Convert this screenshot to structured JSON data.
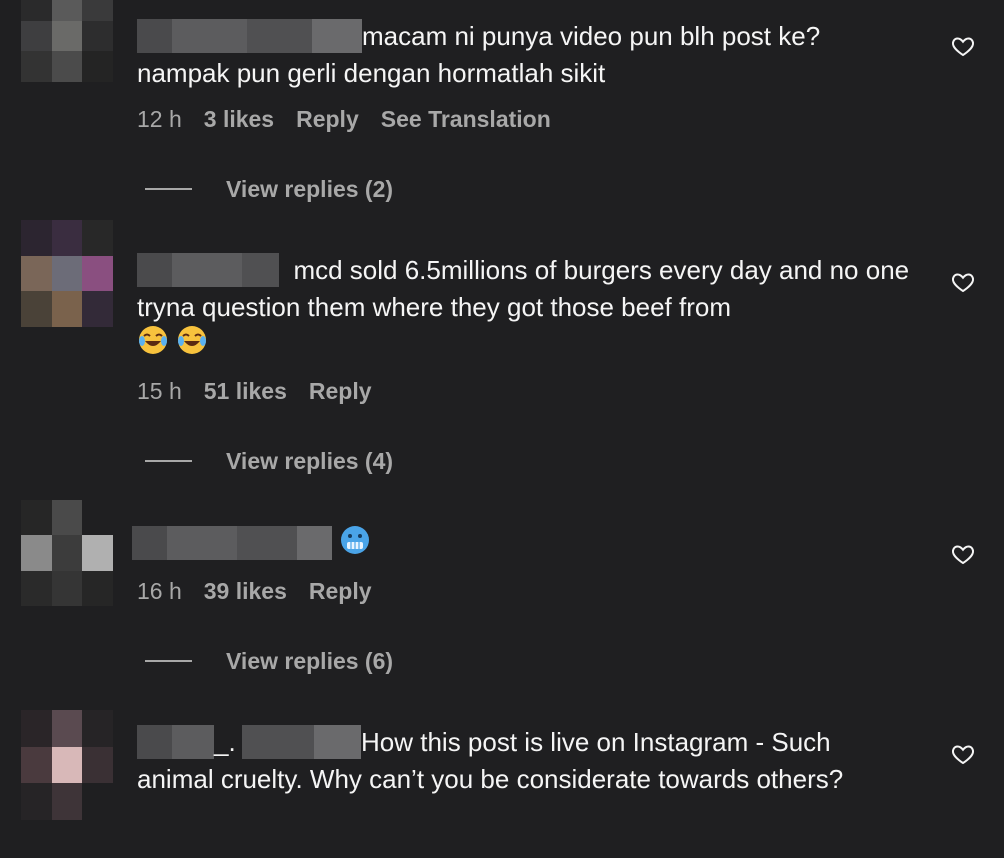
{
  "comments": [
    {
      "text": "macam ni punya video pun blh post ke? nampak pun gerli dengan hormatlah sikit",
      "time": "12 h",
      "likes": "3 likes",
      "reply_label": "Reply",
      "translation_label": "See Translation",
      "view_replies": "View replies (2)"
    },
    {
      "text": "mcd sold 6.5millions of burgers every day and no one tryna question them where they got those beef from",
      "emojis": "laughing-crying-emoji x2",
      "time": "15 h",
      "likes": "51 likes",
      "reply_label": "Reply",
      "view_replies": "View replies (4)"
    },
    {
      "text": "",
      "emojis": "cold-face-emoji",
      "time": "16 h",
      "likes": "39 likes",
      "reply_label": "Reply",
      "view_replies": "View replies (6)"
    },
    {
      "username_fragment": "_.",
      "text": "How this post is live on Instagram - Such animal cruelty. Why can’t you be considerate towards others?"
    }
  ],
  "colors": {
    "background": "#1f1f21",
    "text": "#f5f5f5",
    "secondary": "#a8a8a8"
  },
  "icons": {
    "like": "heart-outline-icon"
  }
}
